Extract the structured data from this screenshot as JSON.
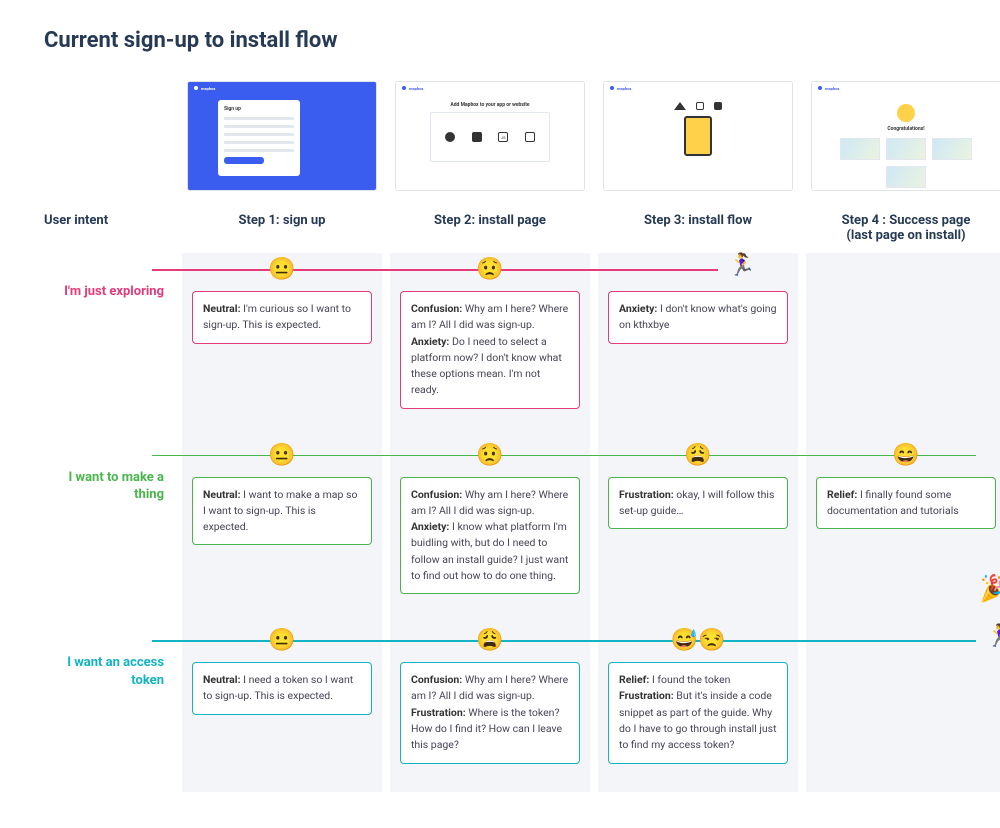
{
  "title": "Current sign-up to install flow",
  "columns": {
    "intent_header": "User intent",
    "steps": [
      {
        "label": "Step 1: sign up",
        "thumb": "signup"
      },
      {
        "label": "Step 2: install page",
        "thumb": "install_page"
      },
      {
        "label": "Step 3: install flow",
        "thumb": "install_flow"
      },
      {
        "label": "Step 4 : Success page",
        "sub": "(last page on install)",
        "thumb": "success"
      }
    ]
  },
  "thumbs": {
    "signup_title": "Sign up",
    "install_title": "Add Mapbox to your app or website",
    "congrats_title": "Congratulations!"
  },
  "personas": [
    {
      "id": "exploring",
      "label": "I'm just exploring",
      "color": "#e63b7a",
      "line_end_col": 3,
      "runner_col": 3,
      "cells": [
        {
          "emoji": "😐",
          "border": "#e63b7a",
          "segments": [
            {
              "b": "Neutral:",
              "t": " I'm curious so I want to sign-up. This is expected."
            }
          ]
        },
        {
          "emoji": "😟",
          "border": "#e63b7a",
          "segments": [
            {
              "b": "Confusion:",
              "t": " Why am I here? Where am I? All I did was sign-up."
            },
            {
              "b": "Anxiety:",
              "t": " Do I need to select a platform now? I don't know what these options mean. I'm not ready."
            }
          ]
        },
        {
          "emoji": "",
          "border": "#e63b7a",
          "segments": [
            {
              "b": "Anxiety:",
              "t": " I don't know what's going on kthxbye"
            }
          ]
        },
        null
      ]
    },
    {
      "id": "make",
      "label": "I want to make a thing",
      "color": "#48b64b",
      "line_end_col": 4,
      "cells": [
        {
          "emoji": "😐",
          "border": "#48b64b",
          "segments": [
            {
              "b": "Neutral:",
              "t": " I want to make a map so I want to sign-up. This is expected."
            }
          ]
        },
        {
          "emoji": "😟",
          "border": "#48b64b",
          "segments": [
            {
              "b": "Confusion:",
              "t": " Why am I here? Where am I? All I did was sign-up."
            },
            {
              "b": "Anxiety:",
              "t": " I know what platform I'm buidling with, but do I need to follow an install guide? I just want to find out how to do one thing."
            }
          ]
        },
        {
          "emoji": "😩",
          "border": "#48b64b",
          "segments": [
            {
              "b": "Frustration:",
              "t": " okay, I will follow this set-up guide…"
            }
          ]
        },
        {
          "emoji": "😄",
          "border": "#48b64b",
          "confetti": true,
          "segments": [
            {
              "b": "Relief:",
              "t": " I finally found some documentation and tutorials"
            }
          ]
        }
      ]
    },
    {
      "id": "token",
      "label": "I want an access token",
      "color": "#12b3c4",
      "line_end_col": 4,
      "runner_col": 4,
      "cells": [
        {
          "emoji": "😐",
          "border": "#12b3c4",
          "segments": [
            {
              "b": "Neutral:",
              "t": " I need a token so I want to sign-up. This is expected."
            }
          ]
        },
        {
          "emoji": "😩",
          "border": "#12b3c4",
          "segments": [
            {
              "b": "Confusion:",
              "t": " Why am I here? Where am I? All I did was sign-up."
            },
            {
              "b": "Frustration:",
              "t": " Where is the token? How do I find it? How can I leave this page?"
            }
          ]
        },
        {
          "emoji": "😅😒",
          "border": "#12b3c4",
          "segments": [
            {
              "b": "Relief:",
              "t": " I found the token"
            },
            {
              "b": "Frustration:",
              "t": " But it's inside a code snippet as part of the guide. Why do I have to go through install just to find my access token?"
            }
          ]
        },
        null
      ]
    }
  ]
}
